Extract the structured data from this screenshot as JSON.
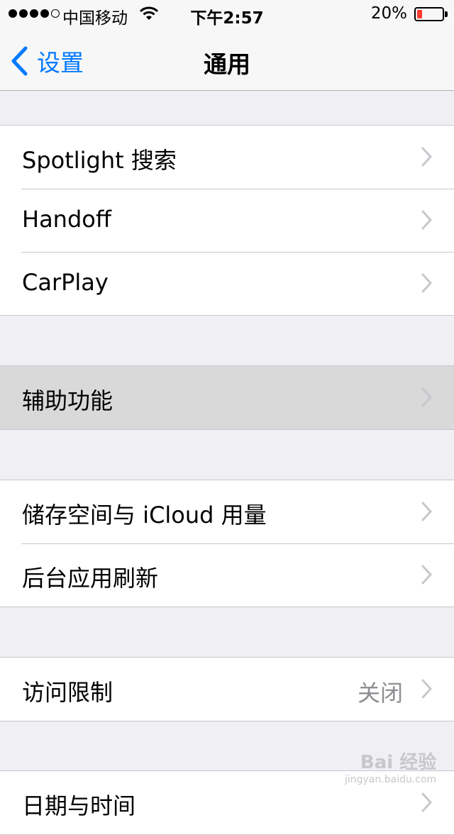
{
  "status_bar": {
    "carrier": "中国移动",
    "time": "下午2:57",
    "battery_percent": "20%",
    "battery_level": 0.2,
    "signal_bars_filled": 4,
    "signal_bars_total": 5
  },
  "nav": {
    "back_label": "设置",
    "title": "通用"
  },
  "groups": [
    {
      "rows": [
        {
          "label": "Spotlight 搜索"
        },
        {
          "label": "Handoff"
        },
        {
          "label": "CarPlay"
        }
      ]
    },
    {
      "rows": [
        {
          "label": "辅助功能",
          "highlighted": true
        }
      ]
    },
    {
      "rows": [
        {
          "label": "储存空间与 iCloud 用量"
        },
        {
          "label": "后台应用刷新"
        }
      ]
    },
    {
      "rows": [
        {
          "label": "访问限制",
          "value": "关闭"
        }
      ]
    },
    {
      "rows": [
        {
          "label": "日期与时间"
        }
      ]
    }
  ],
  "watermark": {
    "text": "Bai 经验",
    "url_text": "jingyan.baidu.com"
  },
  "colors": {
    "accent": "#007aff",
    "background": "#efeff4",
    "battery_low": "#ff3b30",
    "highlight": "#d9d9d9"
  }
}
